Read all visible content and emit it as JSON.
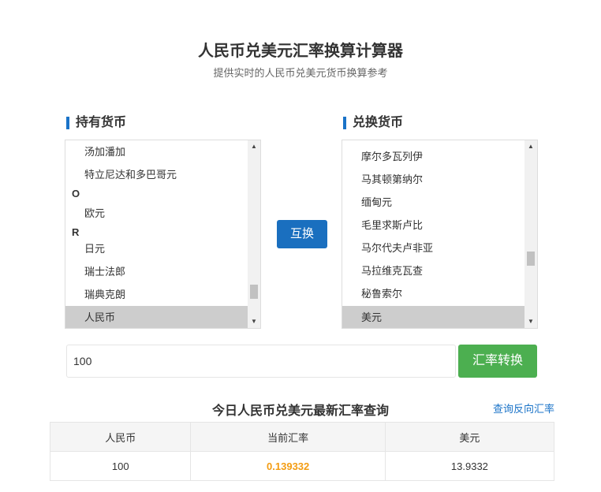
{
  "header": {
    "title": "人民币兑美元汇率换算计算器",
    "subtitle": "提供实时的人民币兑美元货币换算参考"
  },
  "from": {
    "heading": "持有货币",
    "options": [
      "汤加潘加",
      "特立尼达和多巴哥元",
      "O",
      "欧元",
      "R",
      "日元",
      "瑞士法郎",
      "瑞典克朗",
      "人民币"
    ],
    "selected": "人民币"
  },
  "to": {
    "heading": "兑换货币",
    "options": [
      "摩尔多瓦列伊",
      "马其顿第纳尔",
      "缅甸元",
      "毛里求斯卢比",
      "马尔代夫卢非亚",
      "马拉维克瓦查",
      "秘鲁索尔",
      "美元"
    ],
    "selected": "美元"
  },
  "swap_label": "互换",
  "amount_value": "100",
  "convert_label": "汇率转换",
  "result": {
    "title": "今日人民币兑美元最新汇率查询",
    "reverse_link": "查询反向汇率",
    "headers": [
      "人民币",
      "当前汇率",
      "美元"
    ],
    "row": [
      "100",
      "0.139332",
      "13.9332"
    ]
  },
  "colors": {
    "accent": "#1a73c8",
    "swap_button": "#1a6fbf",
    "convert_button": "#4caf50",
    "rate_highlight": "#f39c12"
  }
}
